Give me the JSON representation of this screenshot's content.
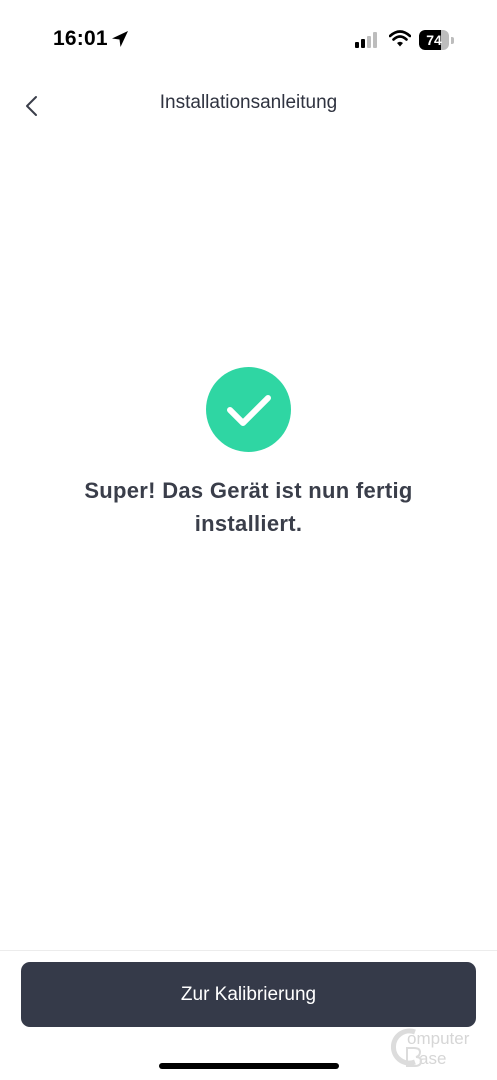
{
  "status_bar": {
    "time": "16:01",
    "battery_level": "74",
    "battery_fraction": 0.74,
    "icons": [
      "location-arrow-icon",
      "cellular-signal-icon",
      "wifi-icon",
      "battery-icon"
    ]
  },
  "nav": {
    "back_icon": "chevron-left-icon",
    "title": "Installationsanleitung"
  },
  "success": {
    "icon": "checkmark-icon",
    "icon_color": "#2fd6a3",
    "message": "Super! Das Gerät ist nun fertig installiert."
  },
  "footer": {
    "button_label": "Zur Kalibrierung",
    "button_color": "#353a49"
  },
  "watermark": {
    "line1": "Computer",
    "line2": "Base"
  }
}
